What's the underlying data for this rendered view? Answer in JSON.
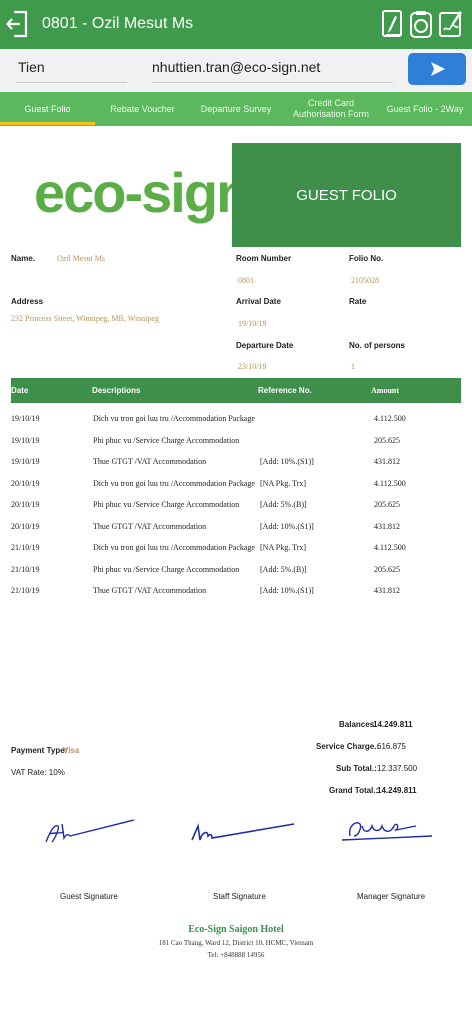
{
  "header": {
    "title": "0801 - Ozil Mesut Ms",
    "back_icon": "exit-door-icon",
    "actions": [
      "edit-document-icon",
      "camera-icon",
      "sign-document-icon"
    ]
  },
  "emailbar": {
    "name_value": "Tien",
    "email_value": "nhuttien.tran@eco-sign.net",
    "send_icon": "send-arrow-icon"
  },
  "tabs": [
    {
      "label": "Guest Folio"
    },
    {
      "label": "Rebate Voucher"
    },
    {
      "label": "Departure Survey"
    },
    {
      "label": "Credit Card Authorisation Form"
    },
    {
      "label": "Guest Folio - 2Way"
    }
  ],
  "document": {
    "logo": {
      "first": "e",
      "rest": "co-sign"
    },
    "banner": "GUEST FOLIO",
    "name_label": "Name.",
    "name_value": "Ozil Mesut Ms",
    "room_label": "Room Number",
    "room_value": "0801",
    "folio_label": "Folio No.",
    "folio_value": "2105028",
    "address_label": "Address",
    "address_value": "232 Princess Street, Winnipeg, MB, Winnipeg",
    "arrival_label": "Arrival Date",
    "arrival_value": "19/10/19",
    "rate_label": "Rate",
    "departure_label": "Departure Date",
    "departure_value": "23/10/19",
    "persons_label": "No. of persons",
    "persons_value": "1",
    "table_headers": {
      "date": "Date",
      "desc": "Descriptions",
      "ref": "Reference No.",
      "amount": "Amount"
    },
    "rows": [
      {
        "date": "19/10/19",
        "desc": "Dich vu tron goi luu tru /Accommodation Package",
        "ref": "",
        "amount": "4.112.500"
      },
      {
        "date": "19/10/19",
        "desc": "Phi phuc vu /Service Charge Accommodation",
        "ref": "",
        "amount": "205.625"
      },
      {
        "date": "19/10/19",
        "desc": "Thue GTGT /VAT Accommodation",
        "ref": "[Add: 10%.(S1)]",
        "amount": "431.812"
      },
      {
        "date": "20/10/19",
        "desc": "Dich vu tron goi luu tru /Accommodation Package",
        "ref": "[NA Pkg. Trx]",
        "amount": "4.112.500"
      },
      {
        "date": "20/10/19",
        "desc": "Phi phuc vu /Service Charge Accommodation",
        "ref": "[Add: 5%.(B)]",
        "amount": "205.625"
      },
      {
        "date": "20/10/19",
        "desc": "Thue GTGT /VAT Accommodation",
        "ref": "[Add: 10%.(S1)]",
        "amount": "431.812"
      },
      {
        "date": "21/10/19",
        "desc": "Dich vu tron goi luu tru /Accommodation Package",
        "ref": "[NA Pkg. Trx]",
        "amount": "4.112.500"
      },
      {
        "date": "21/10/19",
        "desc": "Phi phuc vu /Service Charge Accommodation",
        "ref": "[Add: 5%.(B)]",
        "amount": "205.625"
      },
      {
        "date": "21/10/19",
        "desc": "Thue GTGT /VAT Accommodation",
        "ref": "[Add: 10%.(S1)]",
        "amount": "431.812"
      }
    ],
    "balances_label": "Balances.",
    "balances_value": "14.249.811",
    "service_label": "Service Charge.:",
    "service_value": "616.875",
    "subtotal_label": "Sub Total.:",
    "subtotal_value": "12.337.500",
    "grand_label": "Grand Total.:",
    "grand_value": "14.249.811",
    "payment_label": "Payment Type:",
    "payment_value": "Visa",
    "vat_text": "VAT Rate: 10%",
    "guest_sig_label": "Guest Signature",
    "staff_sig_label": "Staff Signature",
    "manager_sig_label": "Manager Signature",
    "footer_name": "Eco-Sign Saigon Hotel",
    "footer_address": "181 Cao Thang, Ward 12, District 10, HCMC, Vietnam",
    "footer_tel": "Tel: +848888 14956"
  },
  "colors": {
    "primary": "#3f9a4b",
    "tab_bg": "#5cb85c",
    "accent": "#f2c318",
    "send": "#2f7fd9",
    "value_text": "#b9935a"
  }
}
